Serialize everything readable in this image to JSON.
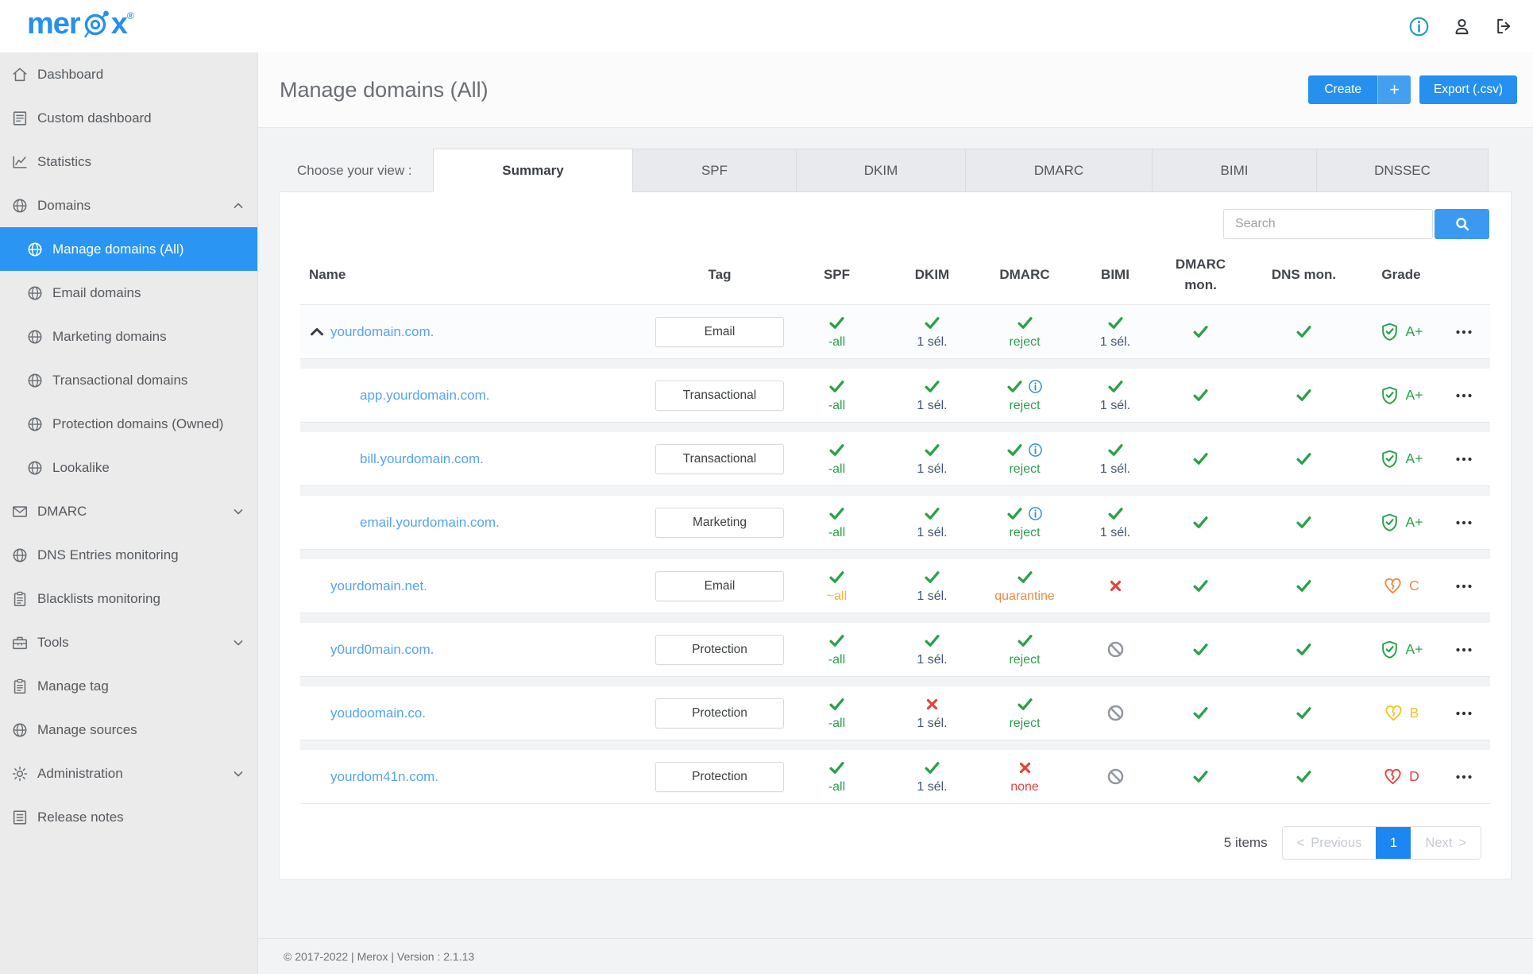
{
  "brand": {
    "name": "merox",
    "registered": "®"
  },
  "topbar": {
    "icons": [
      "info-icon",
      "user-icon",
      "logout-icon"
    ]
  },
  "sidebar": {
    "items": [
      {
        "label": "Dashboard",
        "icon": "home",
        "level": 0
      },
      {
        "label": "Custom dashboard",
        "icon": "journal",
        "level": 0
      },
      {
        "label": "Statistics",
        "icon": "chart",
        "level": 0
      },
      {
        "label": "Domains",
        "icon": "globe",
        "level": 0,
        "chevron": "up"
      },
      {
        "label": "Manage domains (All)",
        "icon": "globe",
        "level": 1,
        "active": true
      },
      {
        "label": "Email domains",
        "icon": "globe",
        "level": 1
      },
      {
        "label": "Marketing domains",
        "icon": "globe",
        "level": 1
      },
      {
        "label": "Transactional domains",
        "icon": "globe",
        "level": 1
      },
      {
        "label": "Protection domains (Owned)",
        "icon": "globe",
        "level": 1
      },
      {
        "label": "Lookalike",
        "icon": "globe",
        "level": 1
      },
      {
        "label": "DMARC",
        "icon": "mail",
        "level": 0,
        "chevron": "down"
      },
      {
        "label": "DNS Entries monitoring",
        "icon": "globe",
        "level": 0
      },
      {
        "label": "Blacklists monitoring",
        "icon": "clipboard",
        "level": 0
      },
      {
        "label": "Tools",
        "icon": "toolbox",
        "level": 0,
        "chevron": "down"
      },
      {
        "label": "Manage tag",
        "icon": "clipboard",
        "level": 0
      },
      {
        "label": "Manage sources",
        "icon": "globe",
        "level": 0
      },
      {
        "label": "Administration",
        "icon": "gear",
        "level": 0,
        "chevron": "down"
      },
      {
        "label": "Release notes",
        "icon": "notes",
        "level": 0
      }
    ]
  },
  "header": {
    "title": "Manage domains (All)",
    "create_label": "Create",
    "create_plus": "+",
    "export_label": "Export (.csv)"
  },
  "tabs": {
    "label": "Choose your view :",
    "items": [
      {
        "label": "Summary",
        "active": true
      },
      {
        "label": "SPF",
        "active": false
      },
      {
        "label": "DKIM",
        "active": false
      },
      {
        "label": "DMARC",
        "active": false
      },
      {
        "label": "BIMI",
        "active": false
      },
      {
        "label": "DNSSEC",
        "active": false
      }
    ]
  },
  "search": {
    "placeholder": "Search"
  },
  "colors": {
    "primary": "#2590ee",
    "sidebar_active": "#2b95f3",
    "link": "#55a3f2",
    "green": "#2aa14b",
    "yellow": "#f2b33d",
    "orange": "#ef8943",
    "red": "#e0453a",
    "slate": "#42526e",
    "ban": "#9097a0",
    "info": "#2e96c0",
    "grade_b": "#f0c330"
  },
  "table": {
    "columns": [
      "Name",
      "Tag",
      "SPF",
      "DKIM",
      "DMARC",
      "BIMI",
      "DMARC mon.",
      "DNS mon.",
      "Grade"
    ],
    "rows": [
      {
        "name": "yourdomain.com.",
        "indent": 0,
        "expander": true,
        "shaded": true,
        "tag": "Email",
        "spf": {
          "icon": "check",
          "text": "-all",
          "color": "green"
        },
        "dkim": {
          "icon": "check",
          "text": "1 sél.",
          "color": "slate"
        },
        "dmarc": {
          "icon": "check",
          "info": false,
          "text": "reject",
          "color": "green"
        },
        "bimi": {
          "icon": "check",
          "text": "1 sél.",
          "color": "slate"
        },
        "dmarc_mon": {
          "icon": "check"
        },
        "dns_mon": {
          "icon": "check"
        },
        "grade": {
          "icon": "shield",
          "letter": "A+",
          "color": "green"
        }
      },
      {
        "name": "app.yourdomain.com.",
        "indent": 1,
        "tag": "Transactional",
        "spf": {
          "icon": "check",
          "text": "-all",
          "color": "green"
        },
        "dkim": {
          "icon": "check",
          "text": "1 sél.",
          "color": "slate"
        },
        "dmarc": {
          "icon": "check",
          "info": true,
          "text": "reject",
          "color": "green"
        },
        "bimi": {
          "icon": "check",
          "text": "1 sél.",
          "color": "slate"
        },
        "dmarc_mon": {
          "icon": "check"
        },
        "dns_mon": {
          "icon": "check"
        },
        "grade": {
          "icon": "shield",
          "letter": "A+",
          "color": "green"
        }
      },
      {
        "name": "bill.yourdomain.com.",
        "indent": 1,
        "tag": "Transactional",
        "spf": {
          "icon": "check",
          "text": "-all",
          "color": "green"
        },
        "dkim": {
          "icon": "check",
          "text": "1 sél.",
          "color": "slate"
        },
        "dmarc": {
          "icon": "check",
          "info": true,
          "text": "reject",
          "color": "green"
        },
        "bimi": {
          "icon": "check",
          "text": "1 sél.",
          "color": "slate"
        },
        "dmarc_mon": {
          "icon": "check"
        },
        "dns_mon": {
          "icon": "check"
        },
        "grade": {
          "icon": "shield",
          "letter": "A+",
          "color": "green"
        }
      },
      {
        "name": "email.yourdomain.com.",
        "indent": 1,
        "tag": "Marketing",
        "spf": {
          "icon": "check",
          "text": "-all",
          "color": "green"
        },
        "dkim": {
          "icon": "check",
          "text": "1 sél.",
          "color": "slate"
        },
        "dmarc": {
          "icon": "check",
          "info": true,
          "text": "reject",
          "color": "green"
        },
        "bimi": {
          "icon": "check",
          "text": "1 sél.",
          "color": "slate"
        },
        "dmarc_mon": {
          "icon": "check"
        },
        "dns_mon": {
          "icon": "check"
        },
        "grade": {
          "icon": "shield",
          "letter": "A+",
          "color": "green"
        }
      },
      {
        "name": "yourdomain.net.",
        "indent": 0,
        "tag": "Email",
        "spf": {
          "icon": "check",
          "text": "~all",
          "color": "yellow"
        },
        "dkim": {
          "icon": "check",
          "text": "1 sél.",
          "color": "slate"
        },
        "dmarc": {
          "icon": "check",
          "info": false,
          "text": "quarantine",
          "color": "orange"
        },
        "bimi": {
          "icon": "cross"
        },
        "dmarc_mon": {
          "icon": "check"
        },
        "dns_mon": {
          "icon": "check"
        },
        "grade": {
          "icon": "heart",
          "letter": "C",
          "color": "orange"
        }
      },
      {
        "name": "y0urd0main.com.",
        "indent": 0,
        "tag": "Protection",
        "spf": {
          "icon": "check",
          "text": "-all",
          "color": "green"
        },
        "dkim": {
          "icon": "check",
          "text": "1 sél.",
          "color": "slate"
        },
        "dmarc": {
          "icon": "check",
          "info": false,
          "text": "reject",
          "color": "green"
        },
        "bimi": {
          "icon": "ban"
        },
        "dmarc_mon": {
          "icon": "check"
        },
        "dns_mon": {
          "icon": "check"
        },
        "grade": {
          "icon": "shield",
          "letter": "A+",
          "color": "green"
        }
      },
      {
        "name": "youdoomain.co.",
        "indent": 0,
        "tag": "Protection",
        "spf": {
          "icon": "check",
          "text": "-all",
          "color": "green"
        },
        "dkim": {
          "icon": "cross",
          "text": "1 sél.",
          "color": "slate"
        },
        "dmarc": {
          "icon": "check",
          "info": false,
          "text": "reject",
          "color": "green"
        },
        "bimi": {
          "icon": "ban"
        },
        "dmarc_mon": {
          "icon": "check"
        },
        "dns_mon": {
          "icon": "check"
        },
        "grade": {
          "icon": "heart",
          "letter": "B",
          "color": "grade_b"
        }
      },
      {
        "name": "yourdom41n.com.",
        "indent": 0,
        "tag": "Protection",
        "spf": {
          "icon": "check",
          "text": "-all",
          "color": "green"
        },
        "dkim": {
          "icon": "check",
          "text": "1 sél.",
          "color": "slate"
        },
        "dmarc": {
          "icon": "cross",
          "info": false,
          "text": "none",
          "color": "red"
        },
        "bimi": {
          "icon": "ban"
        },
        "dmarc_mon": {
          "icon": "check"
        },
        "dns_mon": {
          "icon": "check"
        },
        "grade": {
          "icon": "heart",
          "letter": "D",
          "color": "red"
        }
      }
    ]
  },
  "pagination": {
    "count_label": "5 items",
    "prev_char": "<",
    "prev_label": "Previous",
    "page": "1",
    "next_label": "Next",
    "next_char": ">"
  },
  "footer": {
    "text": "© 2017-2022 | Merox | Version : 2.1.13"
  }
}
